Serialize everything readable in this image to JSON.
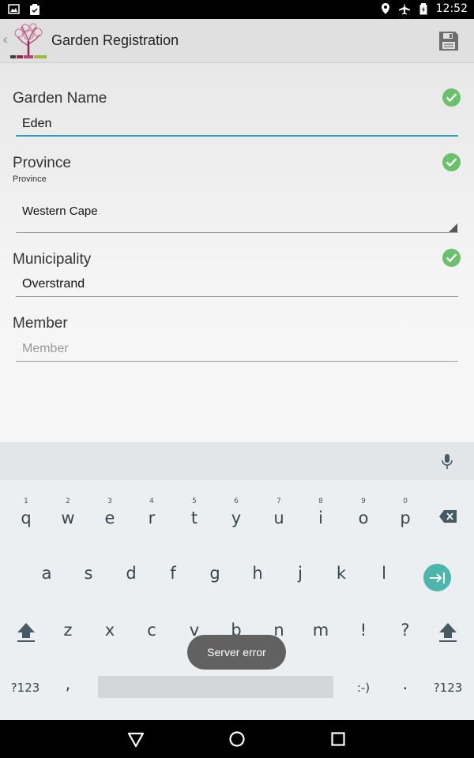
{
  "status_bar": {
    "time": "12:52",
    "icons": [
      "image-icon",
      "clipboard-icon",
      "location-icon",
      "airplane-icon",
      "battery-icon"
    ]
  },
  "action_bar": {
    "back_chevron": "‹",
    "title": "Garden Registration",
    "logo_icon": "tree-logo-icon",
    "save_icon": "save-icon"
  },
  "form": {
    "garden_name": {
      "label": "Garden Name",
      "value": "Eden",
      "valid": true
    },
    "province": {
      "label": "Province",
      "sublabel": "Province",
      "value": "Western Cape",
      "valid": true
    },
    "municipality": {
      "label": "Municipality",
      "value": "Overstrand",
      "valid": true
    },
    "member": {
      "label": "Member",
      "placeholder": "Member",
      "value": ""
    }
  },
  "keyboard": {
    "row1": [
      {
        "k": "q",
        "h": "1"
      },
      {
        "k": "w",
        "h": "2"
      },
      {
        "k": "e",
        "h": "3"
      },
      {
        "k": "r",
        "h": "4"
      },
      {
        "k": "t",
        "h": "5"
      },
      {
        "k": "y",
        "h": "6"
      },
      {
        "k": "u",
        "h": "7"
      },
      {
        "k": "i",
        "h": "8"
      },
      {
        "k": "o",
        "h": "9"
      },
      {
        "k": "p",
        "h": "0"
      }
    ],
    "row2": [
      "a",
      "s",
      "d",
      "f",
      "g",
      "h",
      "j",
      "k",
      "l"
    ],
    "row3": [
      "z",
      "x",
      "c",
      "v",
      "b",
      "n",
      "m",
      "!",
      "?"
    ],
    "symbols_label": "?123",
    "comma": ",",
    "emoji": ":-)",
    "period": ".",
    "symbols_label_right": "?123"
  },
  "toast": {
    "message": "Server error"
  },
  "colors": {
    "accent": "#2a9fd6",
    "check": "#69c26b",
    "enter": "#4db6ac",
    "toast": "#616161"
  }
}
